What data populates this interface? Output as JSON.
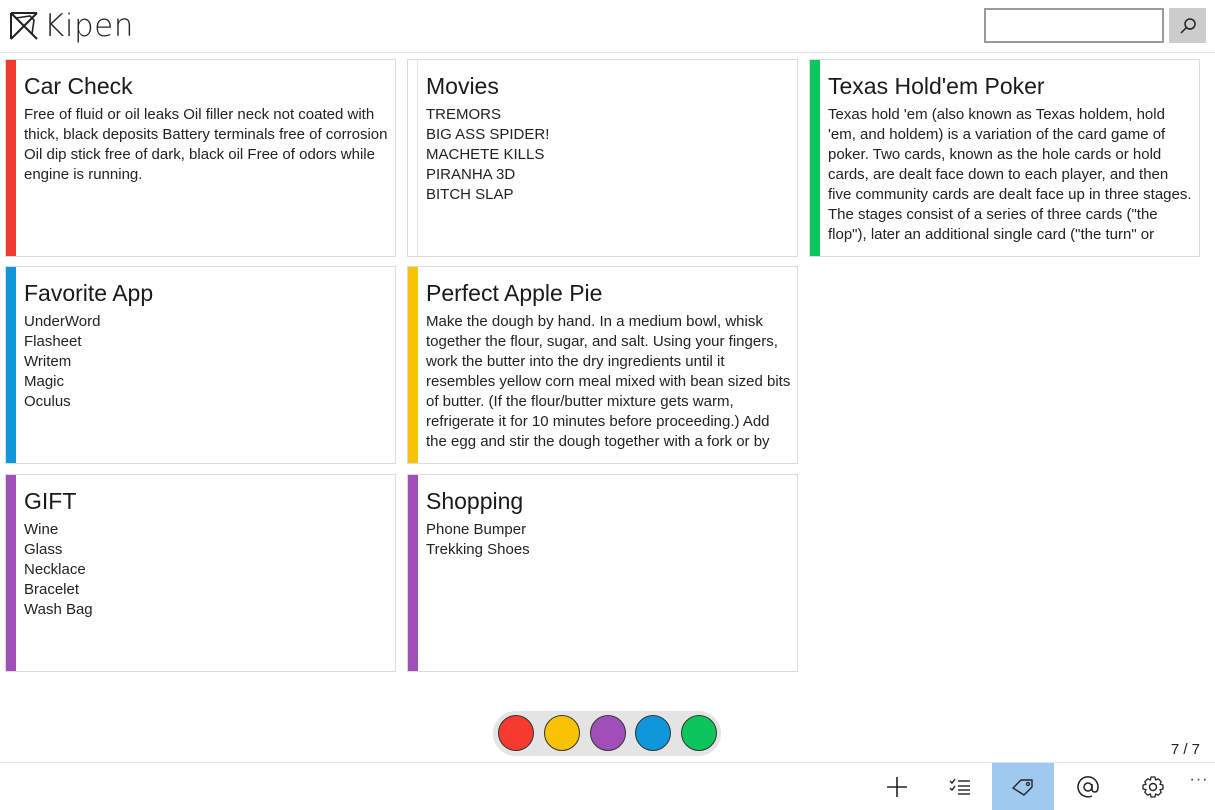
{
  "app": {
    "title": "Kipen"
  },
  "search": {
    "placeholder": "",
    "value": ""
  },
  "notes": [
    {
      "title": "Car Check",
      "body": "Free of fluid or oil leaks Oil filler neck not coated with thick, black deposits Battery terminals free of corrosion Oil dip stick free of dark, black oil Free of odors while engine is running.",
      "color": "#ee3a2f"
    },
    {
      "title": "Movies",
      "body": "TREMORS\nBIG ASS SPIDER!\nMACHETE KILLS\nPIRANHA 3D\nBITCH SLAP",
      "color": "#ffffff"
    },
    {
      "title": "Texas Hold'em Poker",
      "body": "Texas hold 'em (also known as Texas holdem, hold 'em, and holdem) is a variation of the card game of poker. Two cards, known as the hole cards or hold cards, are dealt face down to each player, and then five community cards are dealt face up in three stages. The stages consist of a series of three cards (\"the flop\"), later an additional single card (\"the turn\" or",
      "color": "#0cc65d"
    },
    {
      "title": "Favorite App",
      "body": "UnderWord\nFlasheet\nWritem\nMagic\nOculus",
      "color": "#0f96db"
    },
    {
      "title": "Perfect Apple Pie",
      "body": "Make the dough by hand. In a medium bowl, whisk together the flour, sugar, and salt. Using your fingers, work the butter into the dry ingredients until it resembles yellow corn meal mixed with bean sized bits of butter. (If the flour/butter mixture gets warm, refrigerate it for 10 minutes before proceeding.) Add the egg and stir the dough together with a fork or by",
      "color": "#f9c303"
    },
    {
      "title": "GIFT",
      "body": "Wine\nGlass\nNecklace\nBracelet\nWash Bag",
      "color": "#a04fb8"
    },
    {
      "title": "Shopping",
      "body": "Phone Bumper\nTrekking Shoes",
      "color": "#a04fb8"
    }
  ],
  "palette": {
    "colors": [
      "#f53a2e",
      "#f9c303",
      "#a04fb8",
      "#0f96db",
      "#0cc65d"
    ]
  },
  "page_indicator": "7 / 7",
  "toolbar": {
    "buttons": [
      {
        "icon": "add-icon",
        "active": false
      },
      {
        "icon": "checklist-icon",
        "active": false
      },
      {
        "icon": "tag-icon",
        "active": true
      },
      {
        "icon": "at-icon",
        "active": false
      },
      {
        "icon": "gear-icon",
        "active": false
      }
    ],
    "more_label": "···"
  }
}
